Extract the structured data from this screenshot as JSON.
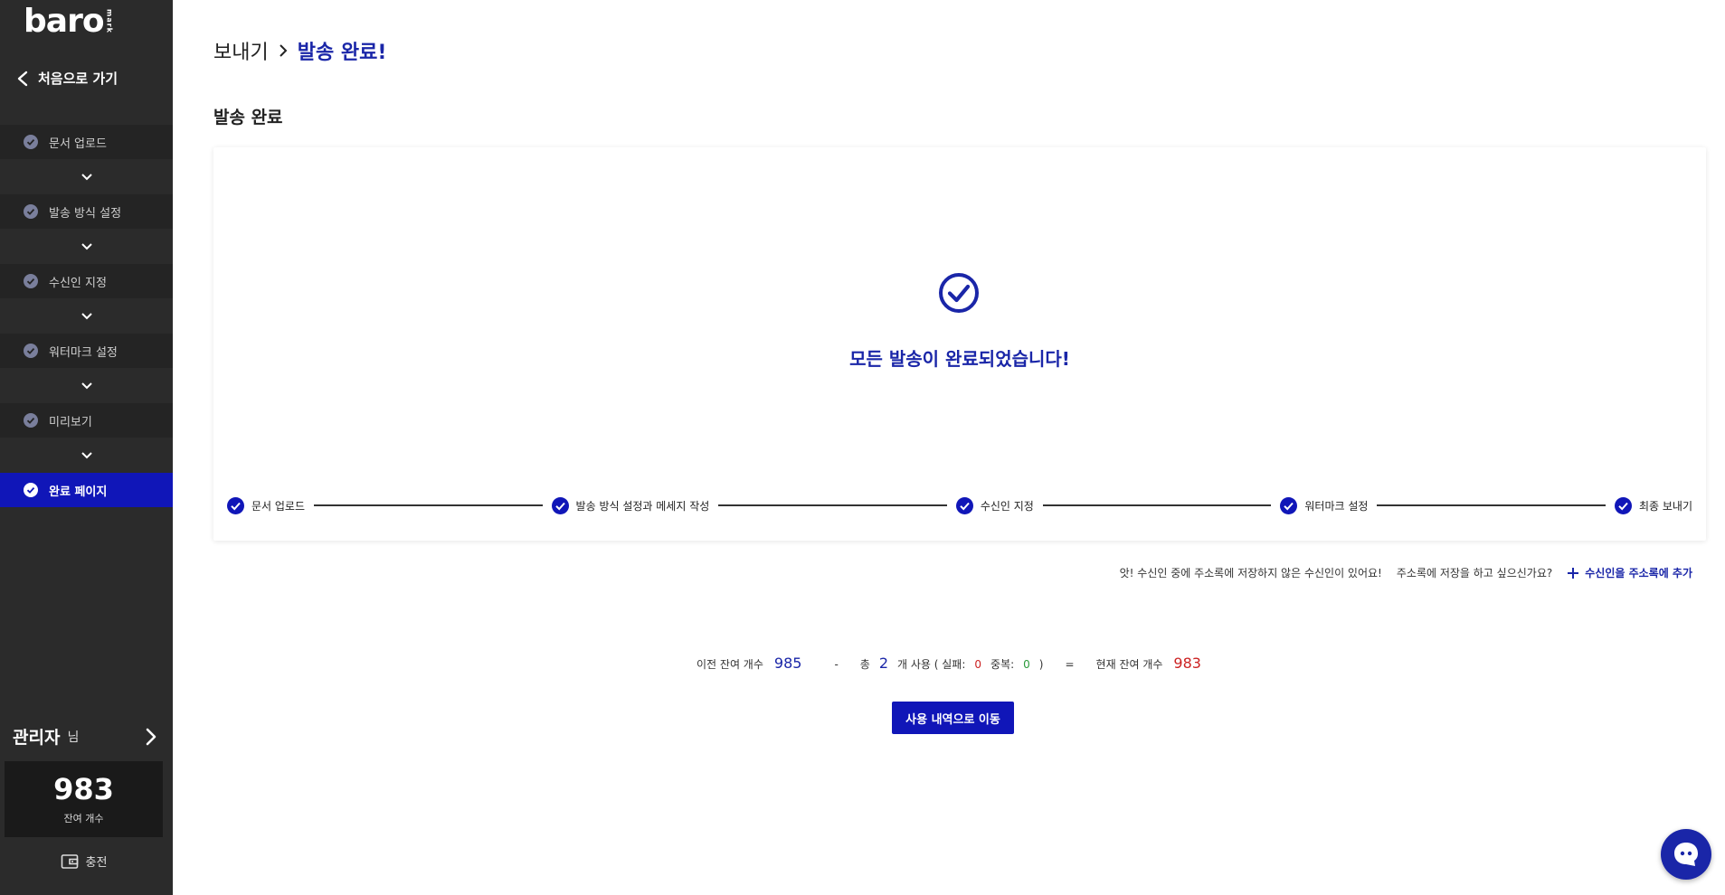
{
  "sidebar": {
    "logo_main": "baro",
    "logo_sub": "mark",
    "back_label": "처음으로 가기",
    "steps": [
      {
        "label": "문서 업로드"
      },
      {
        "label": "발송 방식 설정"
      },
      {
        "label": "수신인 지정"
      },
      {
        "label": "워터마크 설정"
      },
      {
        "label": "미리보기"
      },
      {
        "label": "완료 페이지"
      }
    ],
    "user_name": "관리자",
    "user_suffix": "님",
    "balance": "983",
    "balance_label": "잔여 개수",
    "charge_label": "충전"
  },
  "main": {
    "breadcrumb": [
      "보내기",
      "발송 완료!"
    ],
    "section_title": "발송 완료",
    "done_message": "모든 발송이 완료되었습니다!",
    "progress_steps": [
      "문서 업로드",
      "발송 방식 설정과 메세지 작성",
      "수신인 지정",
      "워터마크 설정",
      "최종 보내기"
    ],
    "notice_1": "앗! 수신인 중에 주소록에 저장하지 않은 수신인이 있어요!",
    "notice_2": "주소록에 저장을 하고 싶으신가요?",
    "add_contacts": "수신인을 주소록에 추가",
    "summary": {
      "prev_label": "이전 잔여 개수",
      "prev_value": "985",
      "minus": "-",
      "total_label": "총",
      "total_value": "2",
      "used_label": "개 사용 ( 실패:",
      "fail_value": "0",
      "dup_label": "중복:",
      "dup_value": "0",
      "close_paren": ")",
      "equals": "=",
      "current_label": "현재 잔여 개수",
      "current_value": "983"
    },
    "history_button": "사용 내역으로 이동"
  },
  "colors": {
    "accent": "#1016b8",
    "sidebar_bg": "#2b2b2b",
    "text_blue": "#1a26a8",
    "red": "#cc2222"
  }
}
